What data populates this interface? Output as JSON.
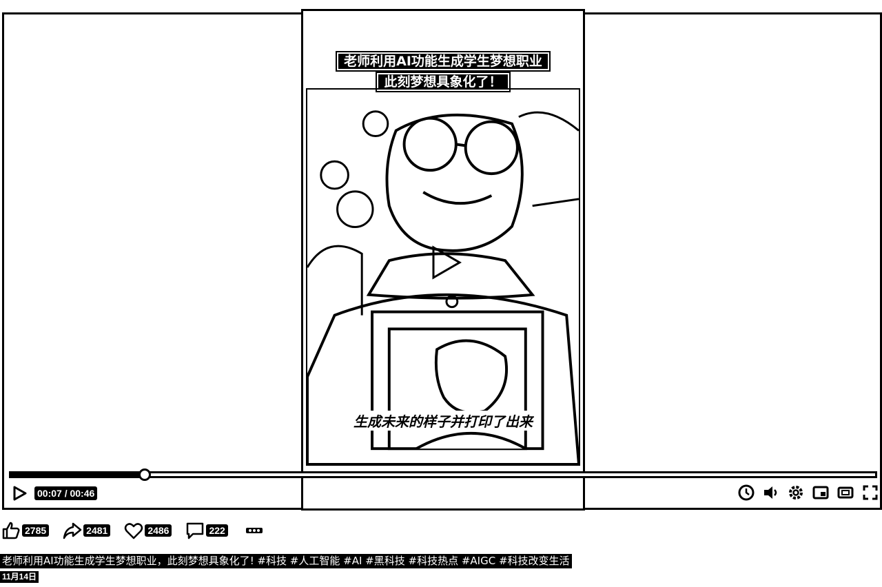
{
  "video": {
    "title_line1": "老师利用AI功能生成学生梦想职业",
    "title_line2": "此刻梦想具象化了！",
    "subtitle": "生成未来的样子并打印了出来"
  },
  "player": {
    "time": "00:07 / 00:46",
    "progress": 0.155,
    "icons": [
      "play-icon",
      "speed-icon",
      "volume-icon",
      "settings-icon",
      "pip-icon",
      "widescreen-icon",
      "fullscreen-icon"
    ]
  },
  "actions": {
    "like_count": "2785",
    "share_count": "2481",
    "favorite_count": "2486",
    "comment_count": "222"
  },
  "post": {
    "description": "老师利用AI功能生成学生梦想职业，此刻梦想具象化了! #科技 #人工智能 #AI #黑科技 #科技热点 #AIGC #科技改变生活",
    "date": "11月14日"
  }
}
